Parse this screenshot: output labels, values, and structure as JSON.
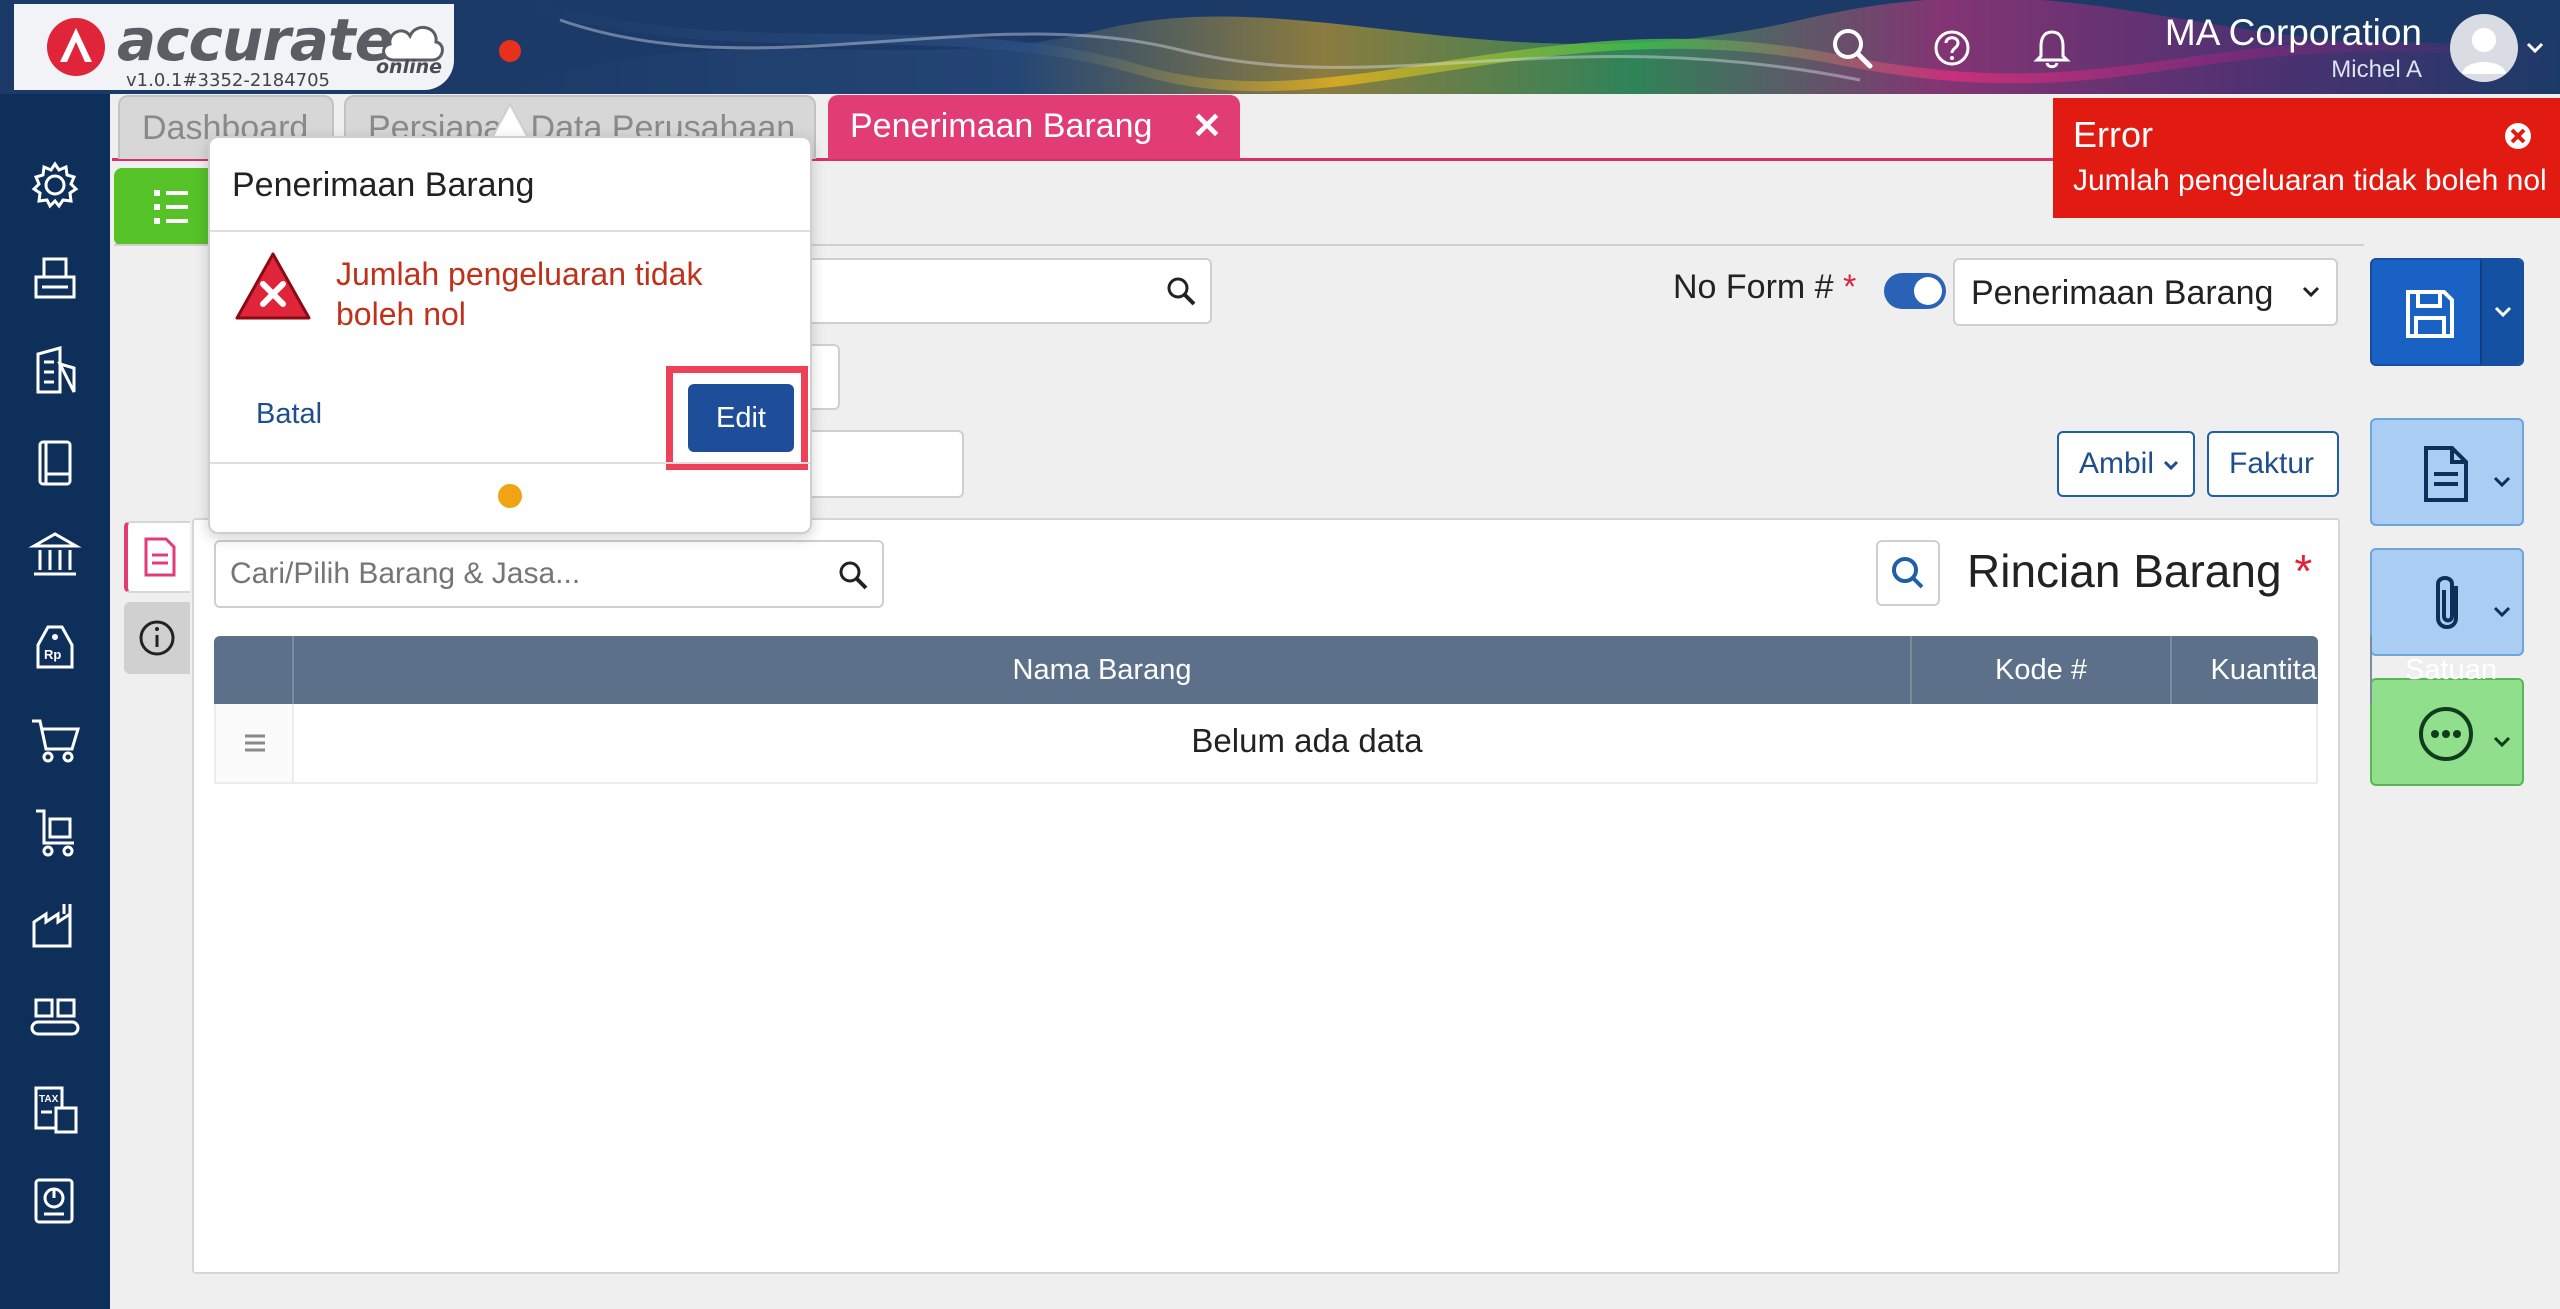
{
  "app": {
    "logo_text": "accurate",
    "logo_sub": "online",
    "version": "v1.0.1#3352-2184705"
  },
  "header": {
    "company": "MA Corporation",
    "user": "Michel A",
    "icons": [
      "search-icon",
      "help-icon",
      "bell-icon",
      "avatar-icon"
    ]
  },
  "sidebar": {
    "items": [
      {
        "icon": "gear-icon"
      },
      {
        "icon": "fax-icon"
      },
      {
        "icon": "building-icon"
      },
      {
        "icon": "book-icon"
      },
      {
        "icon": "bank-icon"
      },
      {
        "icon": "price-tag-icon"
      },
      {
        "icon": "cart-icon"
      },
      {
        "icon": "purchase-cart-icon"
      },
      {
        "icon": "factory-icon"
      },
      {
        "icon": "conveyor-icon"
      },
      {
        "icon": "tax-icon"
      },
      {
        "icon": "report-icon"
      }
    ]
  },
  "tabs": [
    {
      "label": "Dashboard",
      "active": false
    },
    {
      "label": "Persiapan Data Perusahaan",
      "active": false
    },
    {
      "label": "Penerimaan Barang",
      "active": true,
      "close": "✕"
    }
  ],
  "form": {
    "no_form_label": "No Form #",
    "required_mark": "*",
    "type_select": "Penerimaan Barang",
    "ambil_button": "Ambil",
    "faktur_button": "Faktur"
  },
  "details": {
    "search_placeholder": "Cari/Pilih Barang & Jasa...",
    "title": "Rincian Barang",
    "required_mark": "*",
    "columns": [
      "Nama Barang",
      "Kode #",
      "Kuantitas",
      "Satuan"
    ],
    "empty_text": "Belum ada data"
  },
  "toast": {
    "title": "Error",
    "message": "Jumlah pengeluaran tidak boleh nol",
    "color": "#e21b12"
  },
  "dialog": {
    "title": "Penerimaan Barang",
    "message": "Jumlah pengeluaran tidak boleh nol",
    "cancel_label": "Batal",
    "edit_label": "Edit"
  },
  "colors": {
    "accent": "#e23c74",
    "primary": "#1961c3",
    "sidebar": "#0f2f5b",
    "success": "#55c228"
  }
}
